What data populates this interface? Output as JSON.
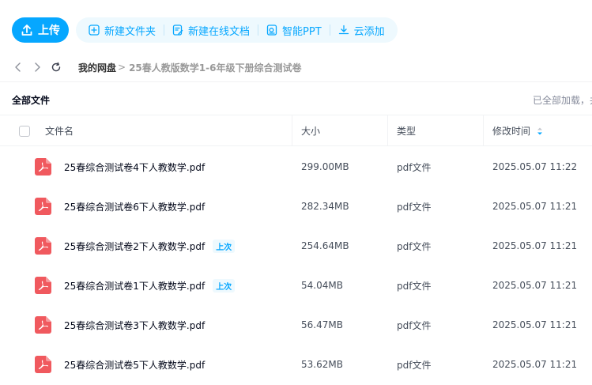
{
  "toolbar": {
    "upload_label": "上传",
    "actions": [
      {
        "label": "新建文件夹",
        "icon": "new-folder-icon"
      },
      {
        "label": "新建在线文档",
        "icon": "online-doc-icon"
      },
      {
        "label": "智能PPT",
        "icon": "smart-ppt-icon"
      },
      {
        "label": "云添加",
        "icon": "cloud-add-icon"
      }
    ]
  },
  "breadcrumb": {
    "root": "我的网盘",
    "separator": ">",
    "current": "25春人教版数学1-6年级下册综合测试卷"
  },
  "list": {
    "title": "全部文件",
    "loaded_note": "已全部加载，共"
  },
  "columns": {
    "name": "文件名",
    "size": "大小",
    "type": "类型",
    "modified": "修改时间"
  },
  "files": [
    {
      "name": "25春综合测试卷4下人教数学.pdf",
      "badge": "",
      "size": "299.00MB",
      "type": "pdf文件",
      "modified": "2025.05.07 11:22"
    },
    {
      "name": "25春综合测试卷6下人教数学.pdf",
      "badge": "",
      "size": "282.34MB",
      "type": "pdf文件",
      "modified": "2025.05.07 11:21"
    },
    {
      "name": "25春综合测试卷2下人教数学.pdf",
      "badge": "上次",
      "size": "254.64MB",
      "type": "pdf文件",
      "modified": "2025.05.07 11:21"
    },
    {
      "name": "25春综合测试卷1下人教数学.pdf",
      "badge": "上次",
      "size": "54.04MB",
      "type": "pdf文件",
      "modified": "2025.05.07 11:21"
    },
    {
      "name": "25春综合测试卷3下人教数学.pdf",
      "badge": "",
      "size": "56.47MB",
      "type": "pdf文件",
      "modified": "2025.05.07 11:21"
    },
    {
      "name": "25春综合测试卷5下人教数学.pdf",
      "badge": "",
      "size": "53.62MB",
      "type": "pdf文件",
      "modified": "2025.05.07 11:21"
    }
  ],
  "colors": {
    "accent": "#06a7ff",
    "pill_bg": "#eef9fe",
    "pdf_red": "#f0595e"
  }
}
